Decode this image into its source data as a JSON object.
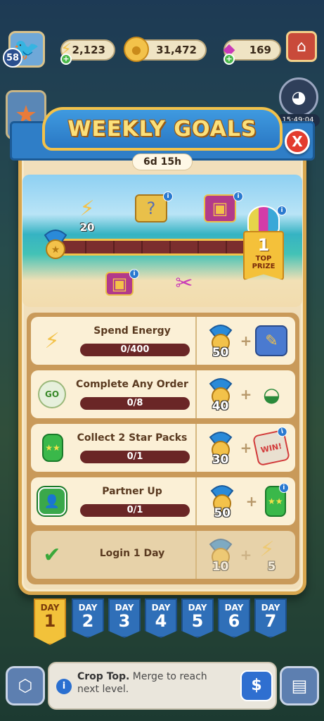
{
  "header": {
    "player_level": "58",
    "energy": "2,123",
    "coins": "31,472",
    "gems": "169",
    "side_timer": "15:49:04"
  },
  "modal": {
    "title": "WEEKLY GOALS",
    "close_label": "X",
    "time_left": "6d 15h",
    "milestones": [
      {
        "label": "20",
        "icon": "energy-bolt-icon"
      },
      {
        "label": "",
        "icon": "mystery-box-icon"
      },
      {
        "label": "",
        "icon": "treasure-chest-icon"
      },
      {
        "label": "",
        "icon": "small-chest-icon"
      },
      {
        "label": "",
        "icon": "scissors-icon"
      }
    ],
    "top_prize": {
      "count": "1",
      "label": "TOP PRIZE"
    },
    "progress": 0.0
  },
  "goals": [
    {
      "title": "Spend Energy",
      "progress": "0/400",
      "reward_medals": "50",
      "reward_item": "paint-box-icon",
      "icon": "energy-icon"
    },
    {
      "title": "Complete Any Order",
      "progress": "0/8",
      "reward_medals": "40",
      "reward_item": "flower-pot-icon",
      "icon": "go-order-icon"
    },
    {
      "title": "Collect 2 Star Packs",
      "progress": "0/1",
      "reward_medals": "30",
      "reward_item": "win-ticket-icon",
      "icon": "star-pack-icon"
    },
    {
      "title": "Partner Up",
      "progress": "0/1",
      "reward_medals": "50",
      "reward_item": "star-pack-icon",
      "icon": "add-partner-icon"
    },
    {
      "title": "Login 1 Day",
      "progress": "",
      "reward_medals": "10",
      "reward_item": "energy-bolt-icon",
      "reward_item_count": "5",
      "icon": "check-icon"
    }
  ],
  "days": [
    {
      "label": "DAY",
      "num": "1"
    },
    {
      "label": "DAY",
      "num": "2"
    },
    {
      "label": "DAY",
      "num": "3"
    },
    {
      "label": "DAY",
      "num": "4"
    },
    {
      "label": "DAY",
      "num": "5"
    },
    {
      "label": "DAY",
      "num": "6"
    },
    {
      "label": "DAY",
      "num": "7"
    }
  ],
  "hint": {
    "strong": "Crop Top.",
    "rest": " Merge to reach next level.",
    "sell_label": "$"
  },
  "colors": {
    "accent_gold": "#f3c24a",
    "banner_blue": "#2f7ec7",
    "bar_red": "#6a2626",
    "close_red": "#e33c2e"
  }
}
